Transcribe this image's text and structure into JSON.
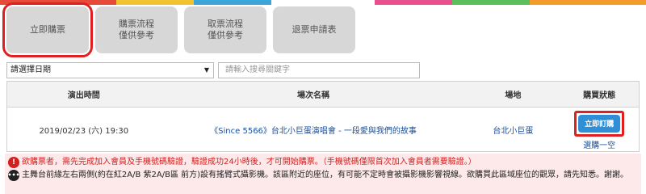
{
  "nav": {
    "buttons": [
      {
        "lines": [
          "立即購票"
        ]
      },
      {
        "lines": [
          "購票流程",
          "僅供參考"
        ]
      },
      {
        "lines": [
          "取票流程",
          "僅供參考"
        ]
      },
      {
        "lines": [
          "退票申請表"
        ]
      }
    ]
  },
  "filters": {
    "date_select": "請選擇日期",
    "search_placeholder": "請輸入搜尋關鍵字"
  },
  "table": {
    "headers": [
      "演出時間",
      "場次名稱",
      "場地",
      "購買狀態"
    ],
    "rows": [
      {
        "time": "2019/02/23 (六) 19:30",
        "name": "《Since 5566》台北小巨蛋演唱會 - 一段愛與我們的故事",
        "venue": "台北小巨蛋",
        "buy_label": "立即訂購",
        "status": "選購一空"
      }
    ]
  },
  "notices": {
    "warning": "欲購票者，需先完成加入會員及手機號碼驗證，驗證成功24小時後，才可開始購票。（手機號碼僅限首次加入會員者需要驗證。）",
    "info": "主舞台前緣左右兩側(約在紅2A/B 紫2A/B區 前方)設有搖臂式攝影機。該區附近的座位，有可能不定時會被攝影機影響視線。欲購買此區域座位的觀眾，請先知悉。謝謝。"
  },
  "colors": {
    "accent_red": "#e02020",
    "link_blue": "#1a4f9c",
    "button_blue": "#2e8fd6",
    "notice_bg": "#fde9ea"
  }
}
